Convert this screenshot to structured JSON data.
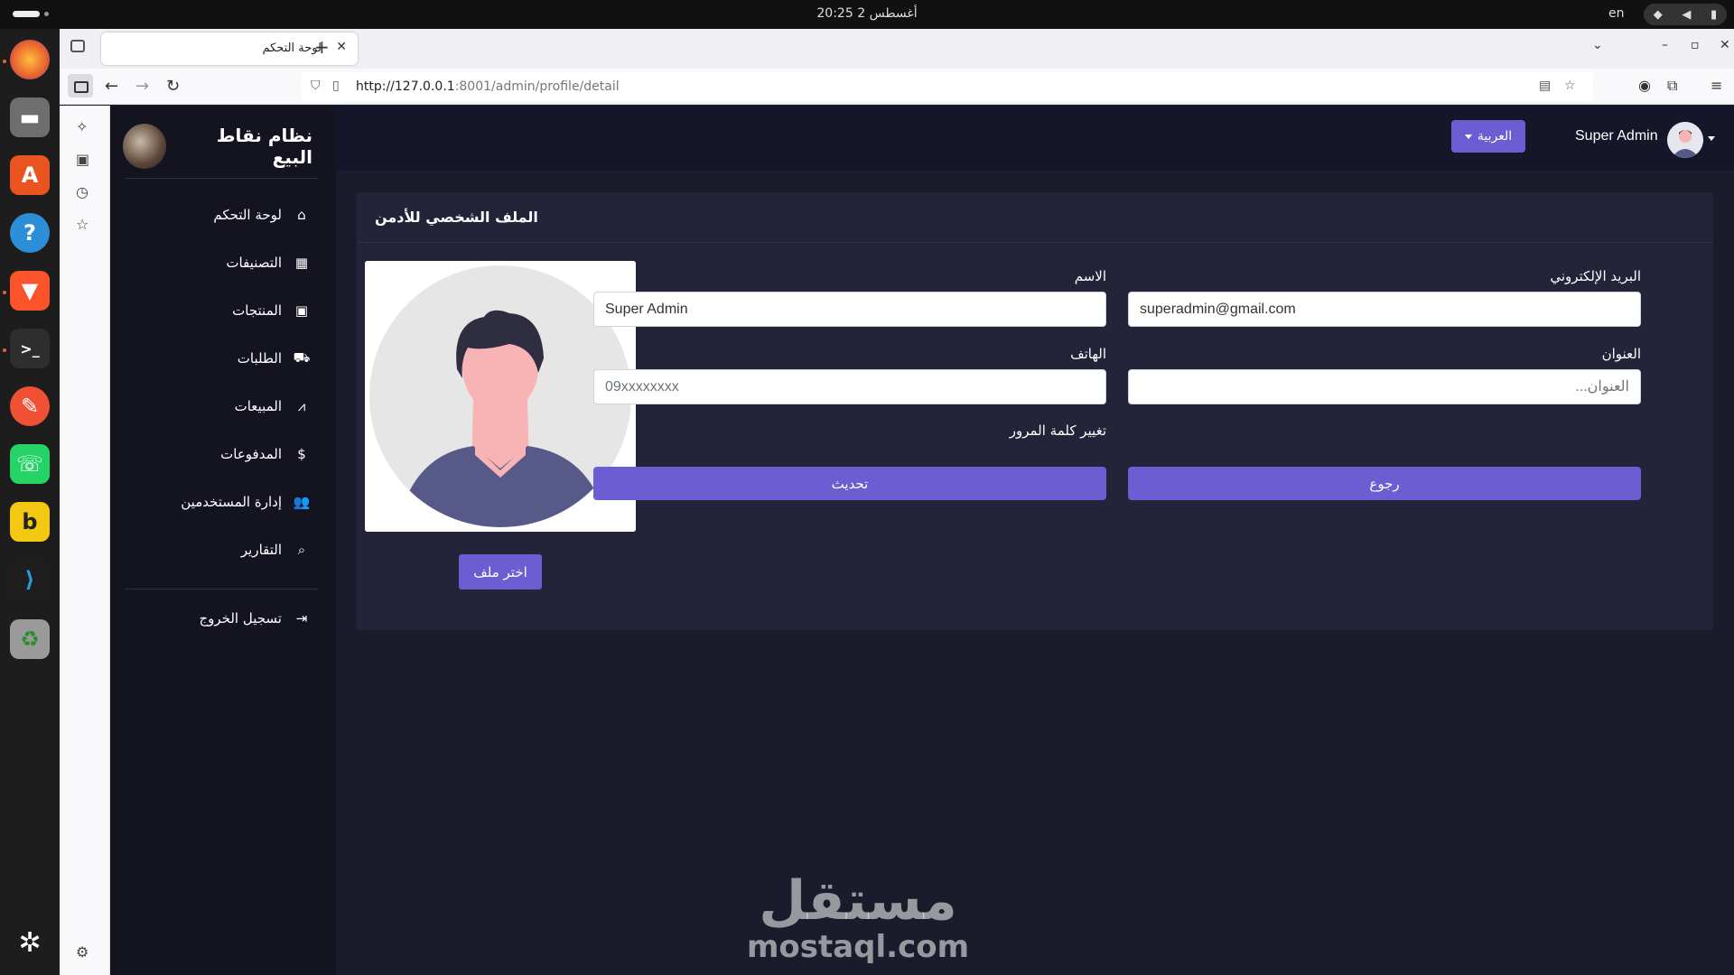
{
  "os": {
    "clock": "أغسطس 2  20:25",
    "keyboard_lang": "en"
  },
  "browser": {
    "tab_title": "لوحة التحكم",
    "url_host": "http://127.0.0.1",
    "url_path": ":8001/admin/profile/detail"
  },
  "app": {
    "brand_title": "نظام نقاط البيع",
    "menu": [
      {
        "label": "لوحة التحكم",
        "icon": "home-icon"
      },
      {
        "label": "التصنيفات",
        "icon": "table-icon"
      },
      {
        "label": "المنتجات",
        "icon": "box-icon"
      },
      {
        "label": "الطلبات",
        "icon": "cart-icon"
      },
      {
        "label": "المبيعات",
        "icon": "chart-icon"
      },
      {
        "label": "المدفوعات",
        "icon": "dollar-icon"
      },
      {
        "label": "إدارة المستخدمين",
        "icon": "users-icon"
      },
      {
        "label": "التقارير",
        "icon": "search-icon"
      }
    ],
    "logout_label": "تسجيل الخروج"
  },
  "topbar": {
    "language_label": "العربية",
    "user_name": "Super Admin"
  },
  "profile": {
    "card_title": "الملف الشخصي للأدمن",
    "choose_file_label": "اختر ملف",
    "name_label": "الاسم",
    "name_value": "Super Admin",
    "email_label": "البريد الإلكتروني",
    "email_value": "superadmin@gmail.com",
    "phone_label": "الهاتف",
    "phone_placeholder": "09xxxxxxxx",
    "address_label": "العنوان",
    "address_placeholder": "العنوان...",
    "change_password_label": "تغيير كلمة المرور",
    "update_label": "تحديث",
    "back_label": "رجوع"
  },
  "watermark": {
    "arabic": "مستقل",
    "latin": "mostaql.com"
  },
  "colors": {
    "accent": "#6c5dd3",
    "sidebar_bg": "#141421",
    "main_bg": "#1b1b2b",
    "card_bg": "#23233a"
  }
}
